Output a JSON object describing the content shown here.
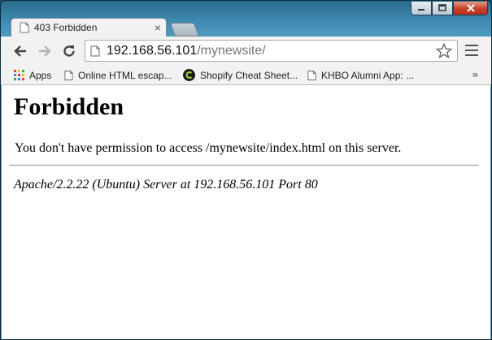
{
  "browser": {
    "tab": {
      "title": "403 Forbidden",
      "close_glyph": "×"
    },
    "address_bar": {
      "host": "192.168.56.101",
      "path": "/mynewsite/"
    },
    "bookmarks": [
      {
        "label": "Apps",
        "icon": "apps-grid-icon"
      },
      {
        "label": "Online HTML escap...",
        "icon": "page-icon"
      },
      {
        "label": "Shopify Cheat Sheet...",
        "icon": "shopify-icon"
      },
      {
        "label": "KHBO Alumni App: ...",
        "icon": "page-icon"
      }
    ],
    "bookmarks_overflow": "»"
  },
  "page": {
    "heading": "Forbidden",
    "message": "You don't have permission to access /mynewsite/index.html on this server.",
    "server_signature": "Apache/2.2.22 (Ubuntu) Server at 192.168.56.101 Port 80"
  },
  "colors": {
    "window_frame": "#3b86ad",
    "close_button": "#c8412b",
    "toolbar_bg": "#f2f2f2",
    "path_text": "#777777"
  }
}
